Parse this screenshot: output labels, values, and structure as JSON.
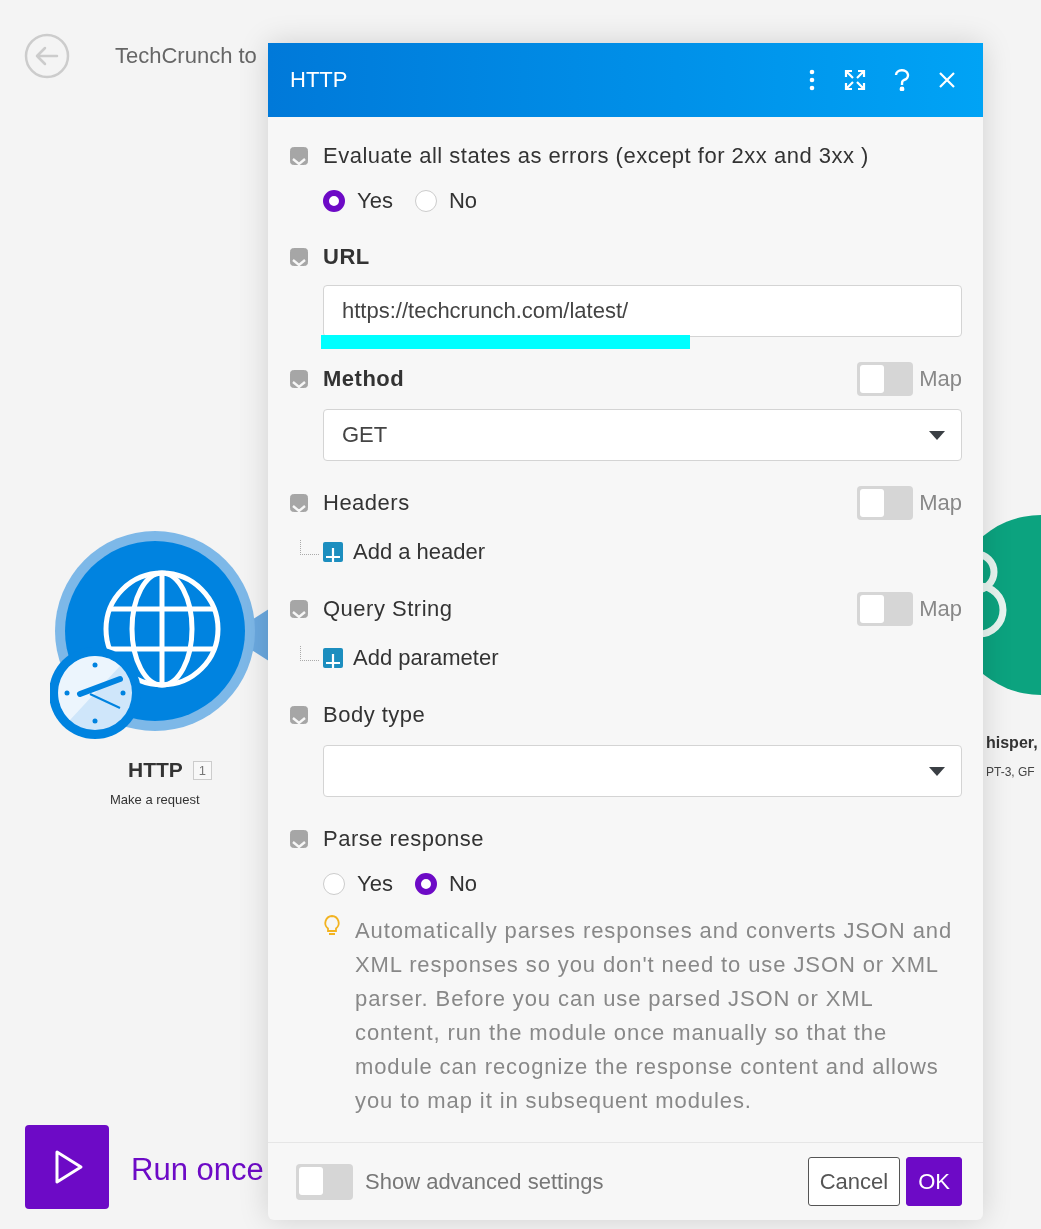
{
  "canvas": {
    "scenario_title": "TechCrunch to",
    "module": {
      "name": "HTTP",
      "number": "1",
      "subtitle": "Make a request"
    },
    "other_module": {
      "name": "hisper,",
      "subtitle": "PT-3, GF"
    },
    "run_button": "Run once"
  },
  "dialog": {
    "title": "HTTP",
    "fields": [
      {
        "kind": "radio",
        "label": "Evaluate all states as errors (except for 2xx and 3xx )",
        "bold": false,
        "checked": true,
        "options": [
          {
            "label": "Yes",
            "selected": true
          },
          {
            "label": "No",
            "selected": false
          }
        ]
      },
      {
        "kind": "text",
        "label": "URL",
        "bold": true,
        "checked": true,
        "value": "https://techcrunch.com/latest/"
      },
      {
        "kind": "select",
        "label": "Method",
        "bold": true,
        "checked": true,
        "map": {
          "label": "Map",
          "on": false
        },
        "value": "GET"
      },
      {
        "kind": "collection",
        "label": "Headers",
        "bold": false,
        "checked": true,
        "map": {
          "label": "Map",
          "on": false
        },
        "add": "Add a header"
      },
      {
        "kind": "collection",
        "label": "Query String",
        "bold": false,
        "checked": true,
        "map": {
          "label": "Map",
          "on": false
        },
        "add": "Add parameter"
      },
      {
        "kind": "select",
        "label": "Body type",
        "bold": false,
        "checked": true
      },
      {
        "kind": "radio",
        "label": "Parse response",
        "bold": false,
        "checked": true,
        "options": [
          {
            "label": "Yes",
            "selected": false
          },
          {
            "label": "No",
            "selected": true
          }
        ],
        "hint": "Automatically parses responses and converts JSON and XML responses so you don't need to use JSON or XML parser. Before you can use parsed JSON or XML content, run the module once manually so that the module can recognize the response content and allows you to map it in subsequent modules."
      }
    ],
    "advanced": {
      "label": "Show advanced settings",
      "on": false
    },
    "buttons": [
      {
        "label": "Cancel",
        "kind": "secondary"
      },
      {
        "label": "OK",
        "kind": "primary"
      }
    ]
  }
}
